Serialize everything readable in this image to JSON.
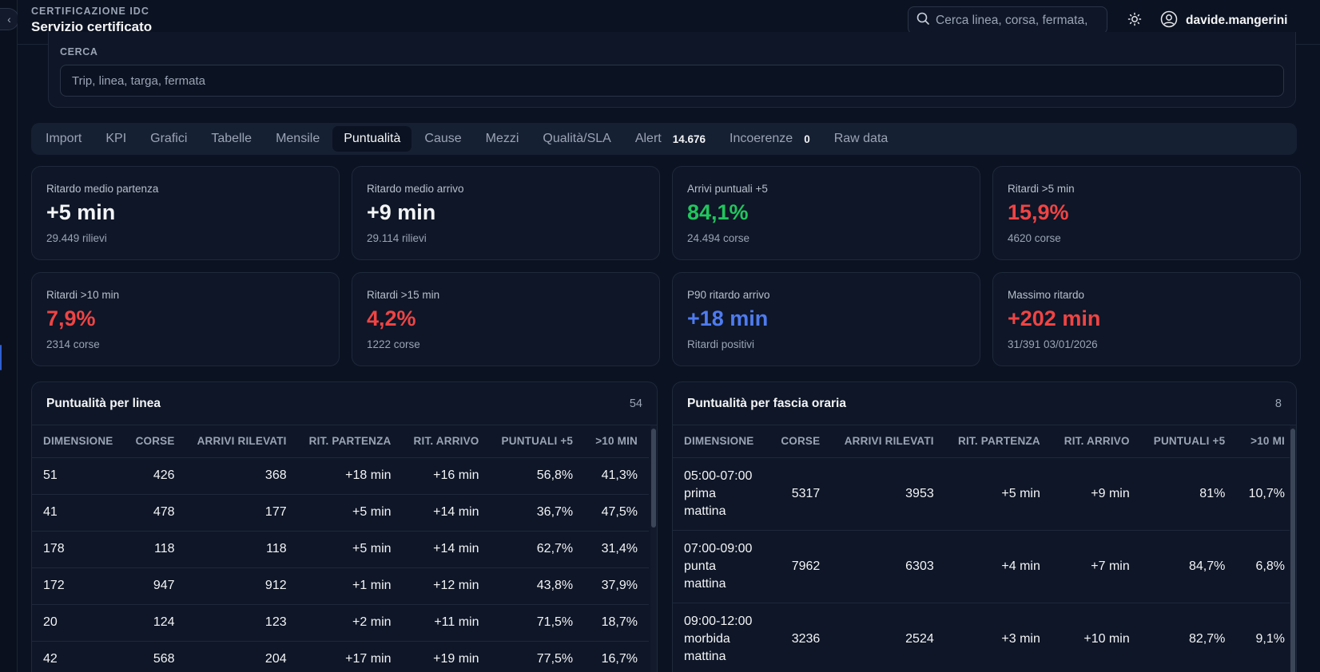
{
  "header": {
    "eyebrow": "CERTIFICAZIONE IDC",
    "title": "Servizio certificato",
    "search_placeholder": "Cerca linea, corsa, fermata,",
    "username": "davide.mangerini"
  },
  "search": {
    "label": "CERCA",
    "placeholder": "Trip, linea, targa, fermata"
  },
  "tabs": [
    {
      "label": "Import"
    },
    {
      "label": "KPI"
    },
    {
      "label": "Grafici"
    },
    {
      "label": "Tabelle"
    },
    {
      "label": "Mensile"
    },
    {
      "label": "Puntualità",
      "active": true
    },
    {
      "label": "Cause"
    },
    {
      "label": "Mezzi"
    },
    {
      "label": "Qualità/SLA"
    },
    {
      "label": "Alert",
      "badge": "14.676"
    },
    {
      "label": "Incoerenze",
      "badge": "0"
    },
    {
      "label": "Raw data"
    }
  ],
  "kpis": [
    {
      "label": "Ritardo medio partenza",
      "value": "+5 min",
      "sub": "29.449 rilievi",
      "tone": "neutral"
    },
    {
      "label": "Ritardo medio arrivo",
      "value": "+9 min",
      "sub": "29.114 rilievi",
      "tone": "neutral"
    },
    {
      "label": "Arrivi puntuali +5",
      "value": "84,1%",
      "sub": "24.494 corse",
      "tone": "green"
    },
    {
      "label": "Ritardi >5 min",
      "value": "15,9%",
      "sub": "4620 corse",
      "tone": "red"
    },
    {
      "label": "Ritardi >10 min",
      "value": "7,9%",
      "sub": "2314 corse",
      "tone": "red"
    },
    {
      "label": "Ritardi >15 min",
      "value": "4,2%",
      "sub": "1222 corse",
      "tone": "red"
    },
    {
      "label": "P90 ritardo arrivo",
      "value": "+18 min",
      "sub": "Ritardi positivi",
      "tone": "blue"
    },
    {
      "label": "Massimo ritardo",
      "value": "+202 min",
      "sub": "31/391 03/01/2026",
      "tone": "red"
    }
  ],
  "by_line": {
    "title": "Puntualità per linea",
    "count": "54",
    "columns": [
      "DIMENSIONE",
      "CORSE",
      "ARRIVI RILEVATI",
      "RIT. PARTENZA",
      "RIT. ARRIVO",
      "PUNTUALI +5",
      ">10 MIN"
    ],
    "rows": [
      [
        "51",
        "426",
        "368",
        "+18 min",
        "+16 min",
        "56,8%",
        "41,3%"
      ],
      [
        "41",
        "478",
        "177",
        "+5 min",
        "+14 min",
        "36,7%",
        "47,5%"
      ],
      [
        "178",
        "118",
        "118",
        "+5 min",
        "+14 min",
        "62,7%",
        "31,4%"
      ],
      [
        "172",
        "947",
        "912",
        "+1 min",
        "+12 min",
        "43,8%",
        "37,9%"
      ],
      [
        "20",
        "124",
        "123",
        "+2 min",
        "+11 min",
        "71,5%",
        "18,7%"
      ],
      [
        "42",
        "568",
        "204",
        "+17 min",
        "+19 min",
        "77,5%",
        "16,7%"
      ]
    ]
  },
  "by_hour": {
    "title": "Puntualità per fascia oraria",
    "count": "8",
    "columns": [
      "DIMENSIONE",
      "CORSE",
      "ARRIVI RILEVATI",
      "RIT. PARTENZA",
      "RIT. ARRIVO",
      "PUNTUALI +5",
      ">10 MI"
    ],
    "rows": [
      [
        "05:00-07:00 prima mattina",
        "5317",
        "3953",
        "+5 min",
        "+9 min",
        "81%",
        "10,7%"
      ],
      [
        "07:00-09:00 punta mattina",
        "7962",
        "6303",
        "+4 min",
        "+7 min",
        "84,7%",
        "6,8%"
      ],
      [
        "09:00-12:00 morbida mattina",
        "3236",
        "2524",
        "+3 min",
        "+10 min",
        "82,7%",
        "9,1%"
      ]
    ]
  }
}
